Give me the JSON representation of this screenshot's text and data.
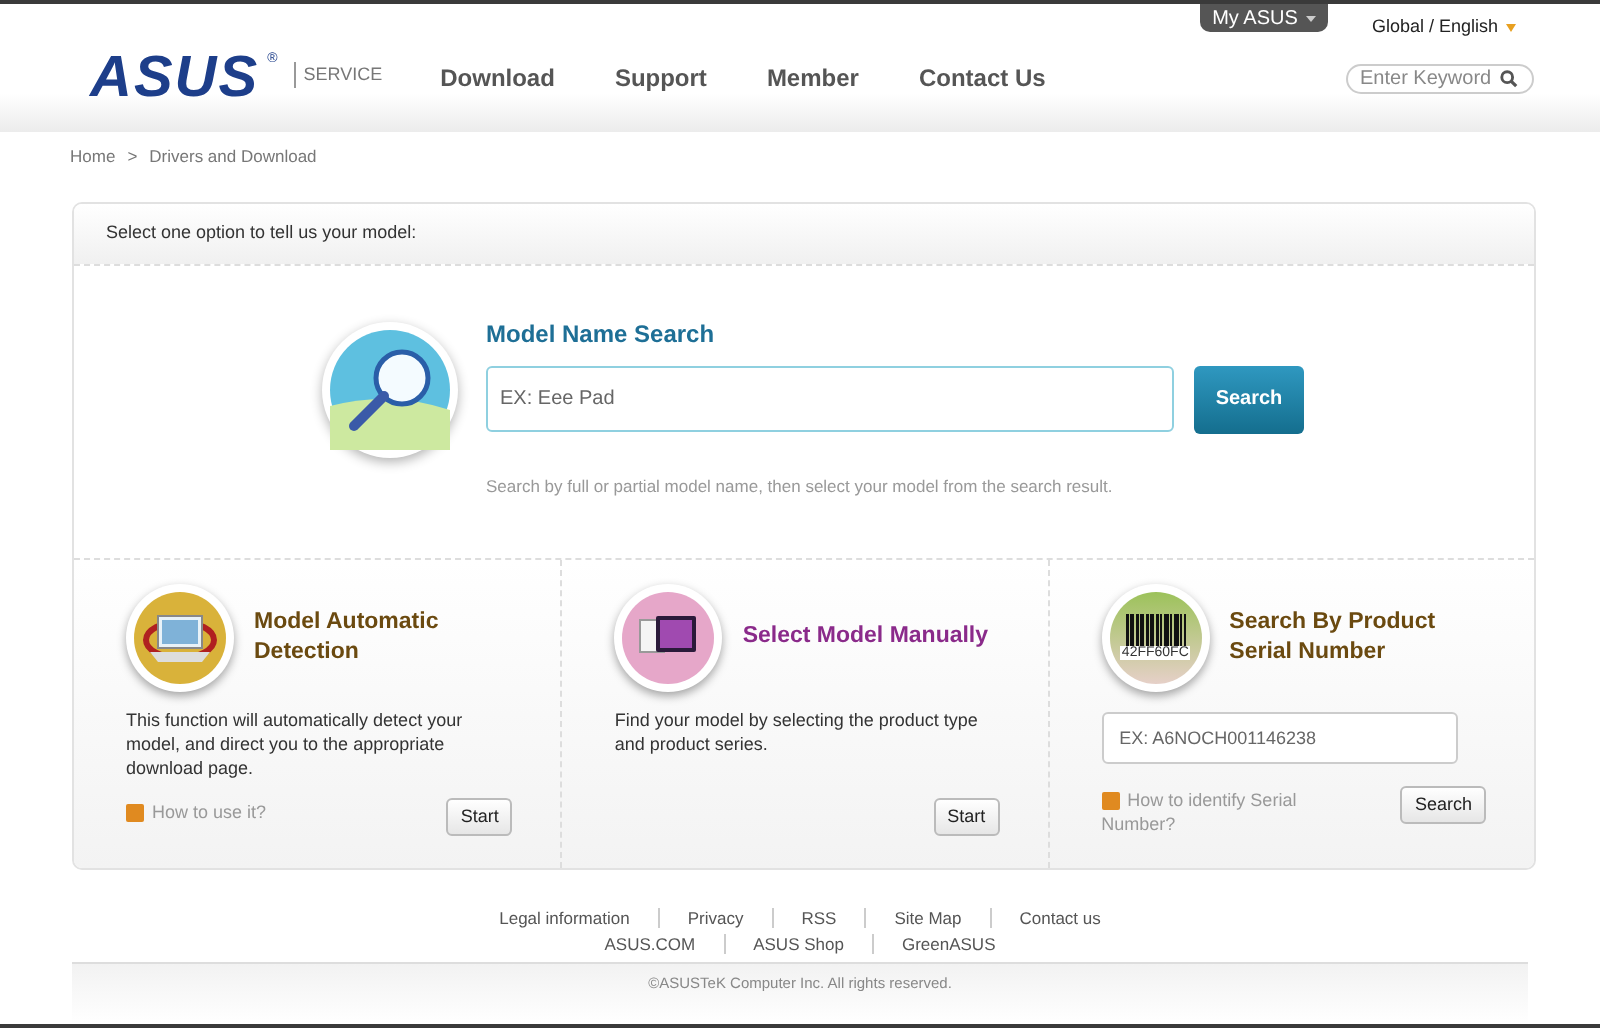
{
  "header": {
    "logo": "ASUS",
    "logo_mark": "®",
    "service": "SERVICE",
    "my_asus": "My ASUS",
    "region": "Global / English",
    "nav": [
      {
        "label": "Download"
      },
      {
        "label": "Support"
      },
      {
        "label": "Member"
      },
      {
        "label": "Contact Us"
      }
    ],
    "search": {
      "placeholder": "Enter Keyword"
    }
  },
  "breadcrumb": [
    {
      "label": "Home"
    },
    {
      "label": "Drivers and Download"
    }
  ],
  "breadcrumb_separator": ">",
  "panel": {
    "prompt": "Select one option to tell us your model:",
    "model_search": {
      "title": "Model Name Search",
      "placeholder": "EX: Eee Pad",
      "button": "Search",
      "hint": "Search by full or partial model name, then select your model from the search result."
    },
    "options": [
      {
        "kind": "detect",
        "title": "Model Automatic Detection",
        "color": "#6b4a10",
        "description": "This function will automatically detect your model, and direct you to the appropriate download page.",
        "help": "How to use it?",
        "button": "Start"
      },
      {
        "kind": "manual",
        "title": "Select Model Manually",
        "color": "#8a2a8a",
        "description": "Find your model by selecting the product type and product series.",
        "button": "Start"
      },
      {
        "kind": "serial",
        "title": "Search By Product Serial Number",
        "color": "#6b4a10",
        "barcode_text": "42FF60FC",
        "placeholder": "EX: A6NOCH001146238",
        "help": "How to identify Serial Number?",
        "button": "Search"
      }
    ]
  },
  "footer": {
    "links": [
      [
        {
          "label": "Legal information"
        },
        {
          "label": "Privacy"
        },
        {
          "label": "RSS"
        },
        {
          "label": "Site Map"
        },
        {
          "label": "Contact us"
        }
      ],
      [
        {
          "label": "ASUS.COM"
        },
        {
          "label": "ASUS Shop"
        },
        {
          "label": "GreenASUS"
        }
      ]
    ],
    "copyright": "©ASUSTeK Computer Inc. All rights reserved."
  }
}
